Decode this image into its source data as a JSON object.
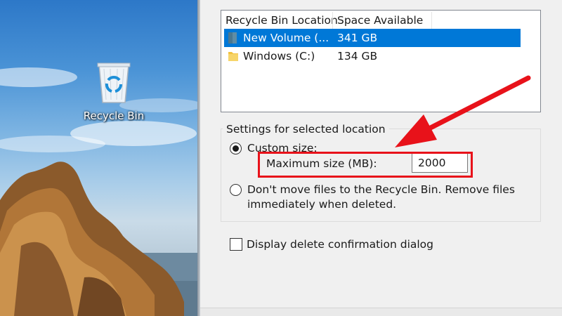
{
  "desktop": {
    "recycle_bin_label": "Recycle Bin",
    "recycle_icon": "recycle-bin-icon"
  },
  "dialog": {
    "list": {
      "columns": [
        "Recycle Bin Location",
        "Space Available"
      ],
      "rows": [
        {
          "location": "New Volume (...",
          "space": "341 GB",
          "icon": "drive-icon",
          "selected": true
        },
        {
          "location": "Windows (C:)",
          "space": "134 GB",
          "icon": "folder-icon",
          "selected": false
        }
      ]
    },
    "settings": {
      "group_label": "Settings for selected location",
      "custom_size_label": "Custom size:",
      "custom_size_checked": true,
      "max_size_label": "Maximum size (MB):",
      "max_size_value": "2000",
      "dont_move_line1": "Don't move files to the Recycle Bin. Remove files",
      "dont_move_line2": "immediately when deleted.",
      "dont_move_checked": false
    },
    "confirm": {
      "label": "Display delete confirmation dialog",
      "checked": false
    }
  },
  "annotation": {
    "color": "#e8121a"
  },
  "colors": {
    "selection": "#0078d7",
    "drive_icon": "#5f8da5",
    "folder_icon": "#f2c240"
  }
}
